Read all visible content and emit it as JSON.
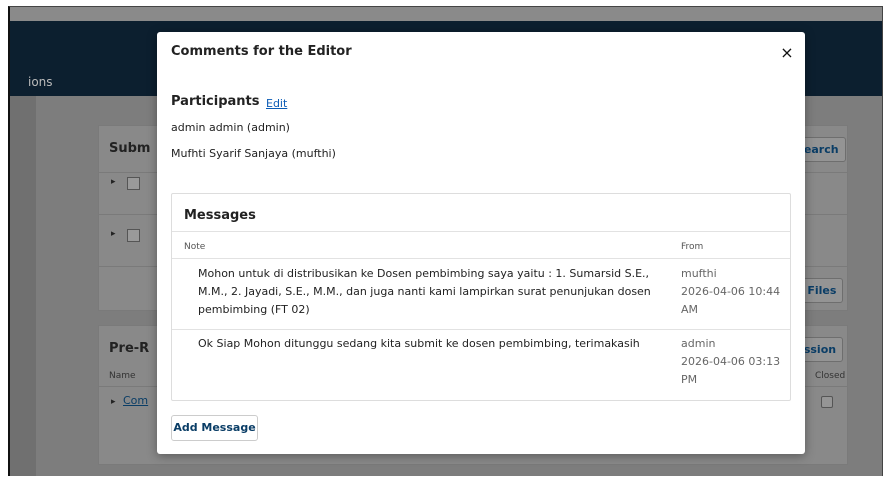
{
  "background": {
    "nav_text": "ions",
    "files_panel": {
      "title": "Subm",
      "search_button": "Search",
      "all_files_button": "ll Files"
    },
    "review_panel": {
      "title": "Pre-R",
      "discussion_button": "ussion",
      "name_column": "Name",
      "closed_column": "Closed",
      "row_link": "Com"
    }
  },
  "modal": {
    "title": "Comments for the Editor",
    "close_symbol": "×",
    "participants": {
      "heading": "Participants",
      "edit_label": "Edit",
      "names": [
        "admin admin (admin)",
        "Mufhti Syarif Sanjaya (mufthi)"
      ]
    },
    "messages": {
      "heading": "Messages",
      "columns": {
        "note": "Note",
        "from": "From"
      },
      "rows": [
        {
          "note": "Mohon untuk di distribusikan ke Dosen pembimbing saya yaitu : 1. Sumarsid S.E., M.M., 2. Jayadi, S.E., M.M., dan juga nanti kami lampirkan surat penunjukan dosen pembimbing (FT 02)",
          "from_user": "mufthi",
          "from_date": "2026-04-06 10:44 AM"
        },
        {
          "note": "Ok Siap Mohon ditunggu sedang kita submit ke dosen pembimbing, terimakasih",
          "from_user": "admin",
          "from_date": "2026-04-06 03:13 PM"
        }
      ]
    },
    "add_message_label": "Add Message"
  }
}
